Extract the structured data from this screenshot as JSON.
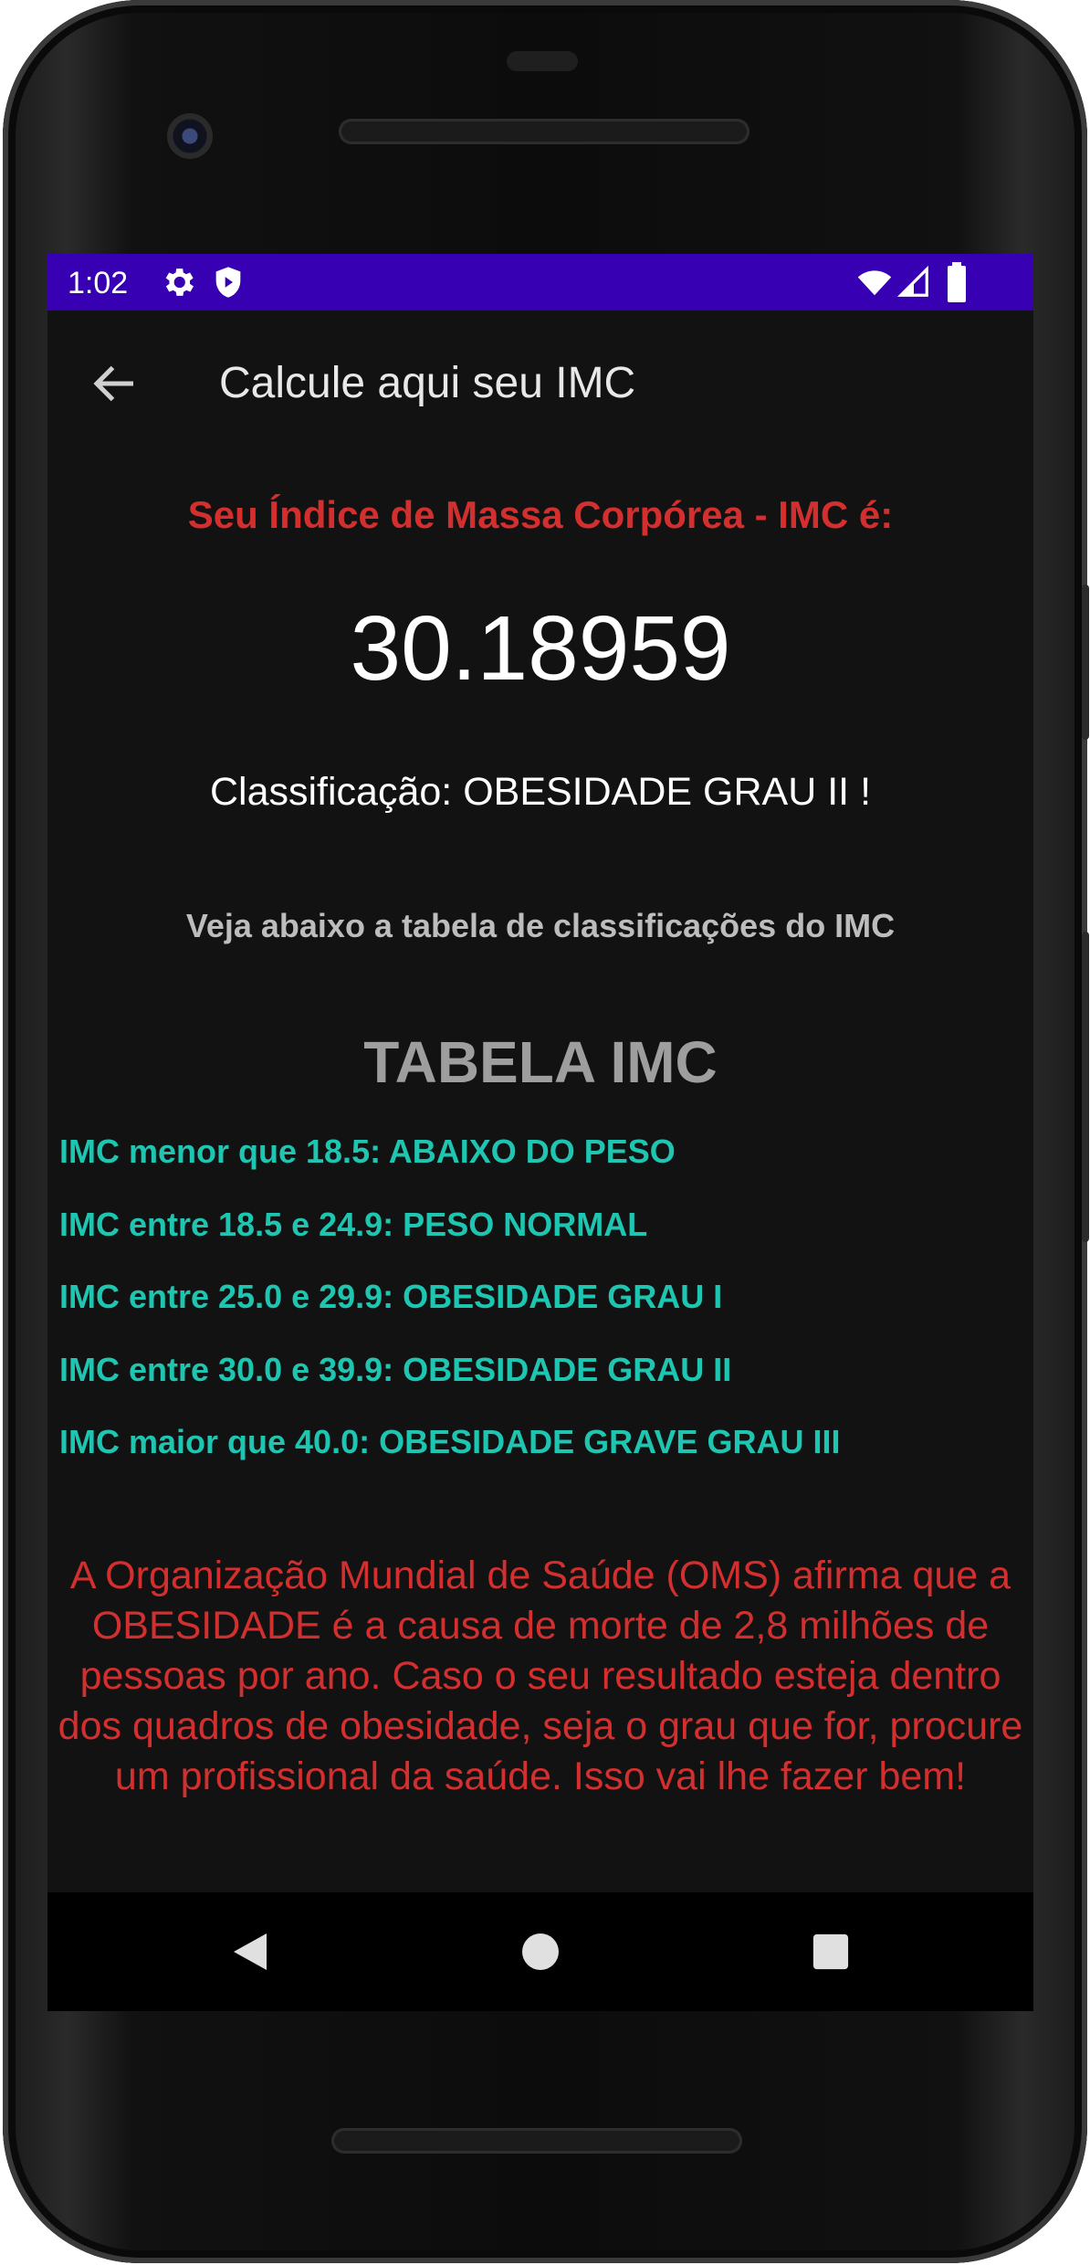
{
  "status_bar": {
    "time": "1:02",
    "background_color": "#3700b3",
    "left_icons": [
      "settings-icon",
      "shield-icon"
    ],
    "right_icons": [
      "wifi-icon",
      "signal-icon",
      "battery-icon"
    ]
  },
  "app_bar": {
    "title": "Calcule aqui seu IMC",
    "back_icon": "arrow-back-icon"
  },
  "result": {
    "heading": "Seu Índice de Massa Corpórea - IMC é:",
    "value": "30.18959",
    "classification": "Classificação: OBESIDADE GRAU II !"
  },
  "info": {
    "see_below": "Veja abaixo a tabela de classificações do IMC"
  },
  "table": {
    "title": "TABELA IMC",
    "rows": [
      "IMC menor que 18.5: ABAIXO DO PESO",
      "IMC entre 18.5 e 24.9: PESO NORMAL",
      "IMC entre 25.0 e 29.9: OBESIDADE GRAU I",
      "IMC entre 30.0 e 39.9: OBESIDADE GRAU II",
      "IMC maior que 40.0: OBESIDADE GRAVE GRAU III"
    ]
  },
  "warning": {
    "text": "A Organização Mundial de Saúde (OMS) afirma que a OBESIDADE é a causa de morte de 2,8 milhões de pessoas por ano. Caso o seu resultado esteja dentro dos quadros de obesidade, seja o grau que for, procure um profissional da saúde. Isso vai lhe fazer bem!"
  },
  "nav_bar": {
    "buttons": [
      "back-triangle-icon",
      "home-circle-icon",
      "recents-square-icon"
    ]
  },
  "colors": {
    "heading_red": "#d32f2f",
    "table_teal": "#1ec6b2",
    "screen_bg": "#121212"
  }
}
